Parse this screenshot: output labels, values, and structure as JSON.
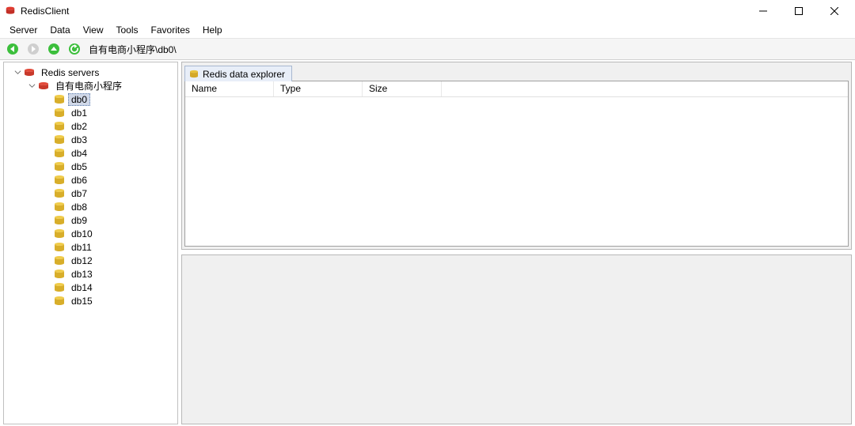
{
  "window": {
    "title": "RedisClient"
  },
  "menu": {
    "items": [
      "Server",
      "Data",
      "View",
      "Tools",
      "Favorites",
      "Help"
    ]
  },
  "toolbar": {
    "breadcrumb": "自有电商小程序\\db0\\"
  },
  "tree": {
    "root_label": "Redis servers",
    "server_label": "自有电商小程序",
    "dbs": [
      "db0",
      "db1",
      "db2",
      "db3",
      "db4",
      "db5",
      "db6",
      "db7",
      "db8",
      "db9",
      "db10",
      "db11",
      "db12",
      "db13",
      "db14",
      "db15"
    ],
    "selected_db": "db0"
  },
  "explorer": {
    "tab_label": "Redis data explorer",
    "columns": {
      "name": "Name",
      "type": "Type",
      "size": "Size"
    }
  }
}
